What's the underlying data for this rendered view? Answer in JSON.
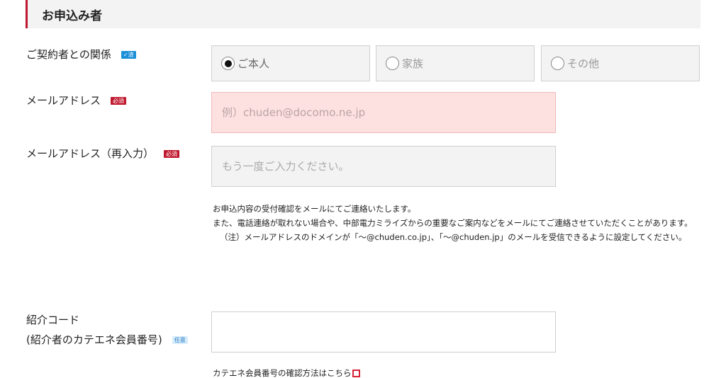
{
  "section": {
    "title": "お申込み者"
  },
  "relationship": {
    "label": "ご契約者との関係",
    "badge": "✓済",
    "options": [
      {
        "label": "ご本人",
        "selected": true
      },
      {
        "label": "家族",
        "selected": false
      },
      {
        "label": "その他",
        "selected": false
      }
    ]
  },
  "email": {
    "label": "メールアドレス",
    "badge": "必須",
    "placeholder": "例）chuden@docomo.ne.jp",
    "value": ""
  },
  "email_confirm": {
    "label": "メールアドレス（再入力）",
    "badge": "必須",
    "placeholder": "もう一度ご入力ください。",
    "value": ""
  },
  "notes": {
    "line1": "お申込内容の受付確認をメールにてご連絡いたします。",
    "line2": "また、電話連絡が取れない場合や、中部電力ミライズからの重要なご案内などをメールにてご連絡させていただくことがあります。",
    "line3": "（注）メールアドレスのドメインが「～@chuden.co.jp」、「～@chuden.jp」のメールを受信できるように設定してください。"
  },
  "referral": {
    "label_line1": "紹介コード",
    "label_line2": "(紹介者のカテエネ会員番号)",
    "badge": "任意",
    "value": ""
  },
  "referral_link": {
    "text": "カテエネ会員番号の確認方法はこちら",
    "icon": "external-link-icon"
  },
  "colors": {
    "accent": "#c0172d",
    "badge_done": "#1b8fd8",
    "error_bg": "#fde0e0",
    "field_bg": "#f3f3f3"
  }
}
